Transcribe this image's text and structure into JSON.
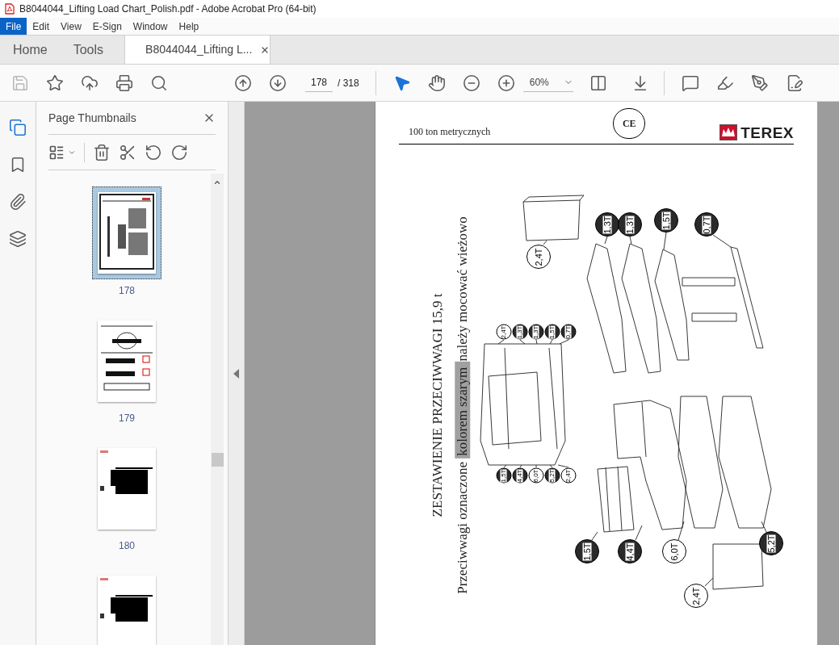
{
  "window": {
    "title": "B8044044_Lifting Load Chart_Polish.pdf - Adobe Acrobat Pro (64-bit)"
  },
  "menu": [
    {
      "label": "File",
      "selected": true
    },
    {
      "label": "Edit",
      "selected": false
    },
    {
      "label": "View",
      "selected": false
    },
    {
      "label": "E-Sign",
      "selected": false
    },
    {
      "label": "Window",
      "selected": false
    },
    {
      "label": "Help",
      "selected": false
    }
  ],
  "tabs": [
    {
      "label": "Home",
      "selected": false
    },
    {
      "label": "Tools",
      "selected": false
    },
    {
      "label": "B8044044_Lifting L...",
      "selected": true
    }
  ],
  "toolbar": {
    "page": "178",
    "page_total": "/ 318",
    "zoom": "60%"
  },
  "sidebar": {
    "title": "Page Thumbnails",
    "thumbnails": [
      {
        "label": "178",
        "kind": "drawing",
        "selected": true
      },
      {
        "label": "179",
        "kind": "diagram",
        "selected": false
      },
      {
        "label": "180",
        "kind": "table",
        "selected": false
      },
      {
        "kind": "table",
        "selected": false
      }
    ]
  },
  "document": {
    "header": "100 ton metrycznych",
    "mark": "CE",
    "logo": "TEREX",
    "title": "ZESTAWIENIE PRZECIWWAGI 15,9 t",
    "subtitle": [
      {
        "text": "Przeciwwagi oznaczone",
        "highlighted": false
      },
      {
        "text": "kolorem szarym",
        "highlighted": true
      },
      {
        "text": "należy mocować wieżowo",
        "highlighted": false
      }
    ],
    "callouts": [
      {
        "text": "2,4T",
        "filled": false
      },
      {
        "text": "1,3T",
        "filled": true
      },
      {
        "text": "1,3T",
        "filled": true
      },
      {
        "text": "1,5T",
        "filled": true
      },
      {
        "text": "0,7T",
        "filled": true
      },
      {
        "text": "2,4T",
        "filled": false
      },
      {
        "text": "1,3T",
        "filled": true
      },
      {
        "text": "1,3T",
        "filled": true
      },
      {
        "text": "1,5T",
        "filled": true
      },
      {
        "text": "0,7T",
        "filled": true
      },
      {
        "text": "1,5T",
        "filled": true
      },
      {
        "text": "4,4T",
        "filled": true
      },
      {
        "text": "6,0T",
        "filled": false
      },
      {
        "text": "5,2T",
        "filled": true
      },
      {
        "text": "2,4T",
        "filled": false
      },
      {
        "text": "1,5T",
        "filled": true
      },
      {
        "text": "4,4T",
        "filled": true
      },
      {
        "text": "6,0T",
        "filled": false
      },
      {
        "text": "5,2T",
        "filled": true
      },
      {
        "text": "2,4T",
        "filled": false
      }
    ]
  }
}
